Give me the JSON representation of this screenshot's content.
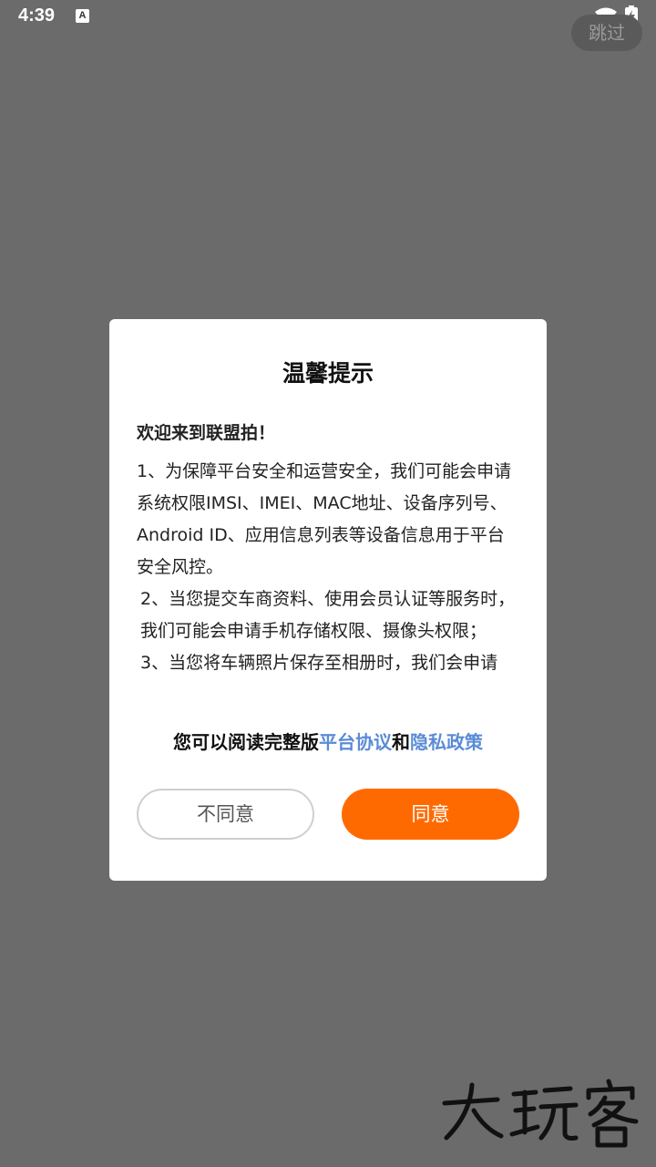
{
  "status_bar": {
    "time": "4:39",
    "notification_icon_letter": "A",
    "icons": [
      "a-notification-icon",
      "wifi-icon",
      "battery-charging-icon"
    ]
  },
  "skip_label": "跳过",
  "dialog": {
    "title": "温馨提示",
    "welcome": "欢迎来到联盟拍！",
    "paragraphs": [
      "1、为保障平台安全和运营安全，我们可能会申请系统权限IMSI、IMEI、MAC地址、设备序列号、Android ID、应用信息列表等设备信息用于平台安全风控。",
      " 2、当您提交车商资料、使用会员认证等服务时，我们可能会申请手机存储权限、摄像头权限；",
      " 3、当您将车辆照片保存至相册时，我们会申请"
    ],
    "agreement_prefix": "您可以阅读完整版",
    "platform_agreement_link": "平台协议",
    "agreement_and": "和",
    "privacy_policy_link": "隐私政策",
    "disagree_label": "不同意",
    "agree_label": "同意"
  },
  "colors": {
    "overlay": "#6b6b6b",
    "accent": "#ff6a00",
    "link": "#5a8bd6"
  }
}
